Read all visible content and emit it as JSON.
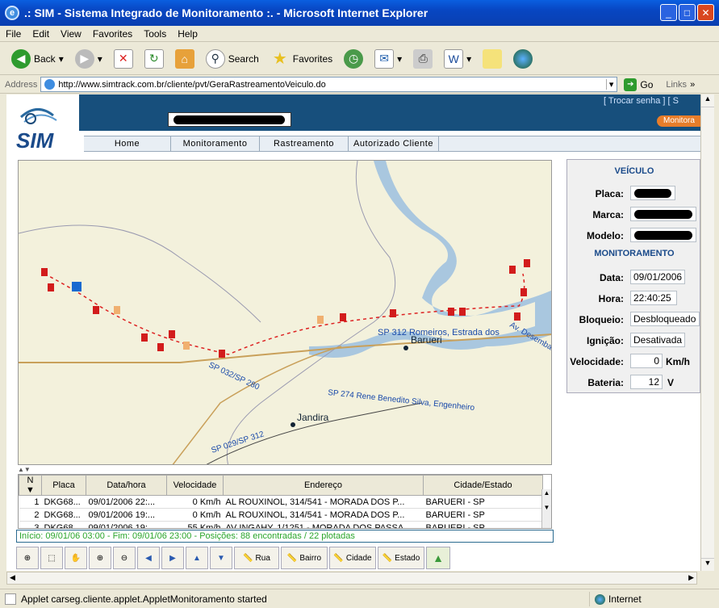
{
  "window": {
    "title": ".: SIM - Sistema Integrado de Monitoramento :. - Microsoft Internet Explorer"
  },
  "menu": [
    "File",
    "Edit",
    "View",
    "Favorites",
    "Tools",
    "Help"
  ],
  "toolbar": {
    "back": "Back",
    "search": "Search",
    "favorites": "Favorites"
  },
  "address": {
    "label": "Address",
    "url": "http://www.simtrack.com.br/cliente/pvt/GeraRastreamentoVeiculo.do",
    "go": "Go",
    "links": "Links"
  },
  "header": {
    "logo": "SIM",
    "links_text": "[ Trocar senha ] [ S",
    "monitor_btn": "Monitora"
  },
  "nav": [
    "Home",
    "Monitoramento",
    "Rastreamento",
    "Autorizado Cliente"
  ],
  "map_labels": [
    "SP 312 Romeiros, Estrada dos",
    "Barueri",
    "Av. Desembarg",
    "SP 032/SP 280",
    "SP 274 Rene Benedito Silva, Engenheiro",
    "Jandira",
    "SP 029/SP 312"
  ],
  "vehicle": {
    "section": "VEÍCULO",
    "placa_label": "Placa:",
    "marca_label": "Marca:",
    "modelo_label": "Modelo:"
  },
  "monitor": {
    "section": "MONITORAMENTO",
    "data_label": "Data:",
    "data": "09/01/2006",
    "hora_label": "Hora:",
    "hora": "22:40:25",
    "bloqueio_label": "Bloqueio:",
    "bloqueio": "Desbloqueado",
    "ignicao_label": "Ignição:",
    "ignicao": "Desativada",
    "velocidade_label": "Velocidade:",
    "velocidade": "0",
    "vel_unit": "Km/h",
    "bateria_label": "Bateria:",
    "bateria": "12",
    "bat_unit": "V"
  },
  "grid": {
    "headers": [
      "N ▼",
      "Placa",
      "Data/hora",
      "Velocidade",
      "Endereço",
      "Cidade/Estado"
    ],
    "rows": [
      [
        "1",
        "DKG68...",
        "09/01/2006 22:...",
        "0 Km/h",
        "AL ROUXINOL, 314/541 - MORADA DOS P...",
        "BARUERI - SP"
      ],
      [
        "2",
        "DKG68...",
        "09/01/2006 19:...",
        "0 Km/h",
        "AL ROUXINOL, 314/541 - MORADA DOS P...",
        "BARUERI - SP"
      ],
      [
        "3",
        "DKG68...",
        "09/01/2006 19:...",
        "55 Km/h",
        "AV INGAHY, 1/1251 - MORADA DOS PASSA...",
        "BARUERI - SP"
      ]
    ]
  },
  "summary": "Início: 09/01/06 03:00 - Fim: 09/01/06 23:00 - Posições: 88 encontradas / 22 plotadas",
  "maptools": {
    "rua": "Rua",
    "bairro": "Bairro",
    "cidade": "Cidade",
    "estado": "Estado"
  },
  "status": {
    "text": "Applet carseg.cliente.applet.AppletMonitoramento started",
    "zone": "Internet"
  }
}
